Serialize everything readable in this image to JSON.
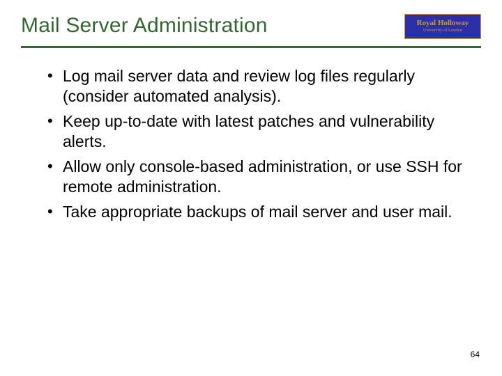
{
  "header": {
    "title": "Mail Server Administration",
    "logo": {
      "line1": "Royal Holloway",
      "line2": "University of London"
    }
  },
  "bullets": [
    "Log mail server data and review log files regularly (consider automated analysis).",
    "Keep up-to-date with latest patches and vulnerability alerts.",
    "Allow only console-based administration, or use SSH for remote administration.",
    "Take appropriate backups of mail server and user mail."
  ],
  "page_number": "64"
}
